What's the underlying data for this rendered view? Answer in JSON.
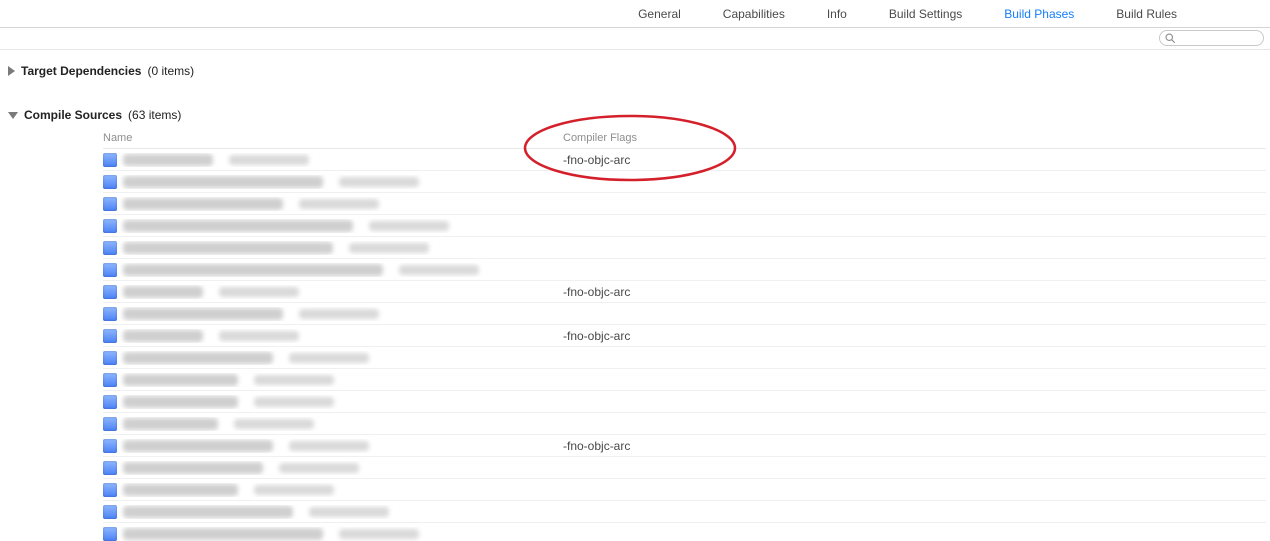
{
  "tabs": {
    "general": "General",
    "capabilities": "Capabilities",
    "info": "Info",
    "build_settings": "Build Settings",
    "build_phases": "Build Phases",
    "build_rules": "Build Rules",
    "active": "build_phases"
  },
  "search": {
    "placeholder": ""
  },
  "sections": {
    "target_deps": {
      "title": "Target Dependencies",
      "count_label": "(0 items)"
    },
    "compile_sources": {
      "title": "Compile Sources",
      "count_label": "(63 items)"
    }
  },
  "columns": {
    "name": "Name",
    "flags": "Compiler Flags"
  },
  "arc_flag": "-fno-objc-arc",
  "rows": [
    {
      "nw": 90,
      "pw": 80,
      "flag_key": "arc_flag"
    },
    {
      "nw": 200,
      "pw": 80,
      "flag_key": null
    },
    {
      "nw": 160,
      "pw": 80,
      "flag_key": null
    },
    {
      "nw": 230,
      "pw": 80,
      "flag_key": null
    },
    {
      "nw": 210,
      "pw": 80,
      "flag_key": null
    },
    {
      "nw": 260,
      "pw": 80,
      "flag_key": null
    },
    {
      "nw": 80,
      "pw": 80,
      "flag_key": "arc_flag"
    },
    {
      "nw": 160,
      "pw": 80,
      "flag_key": null
    },
    {
      "nw": 80,
      "pw": 80,
      "flag_key": "arc_flag"
    },
    {
      "nw": 150,
      "pw": 80,
      "flag_key": null
    },
    {
      "nw": 115,
      "pw": 80,
      "flag_key": null
    },
    {
      "nw": 115,
      "pw": 80,
      "flag_key": null
    },
    {
      "nw": 95,
      "pw": 80,
      "flag_key": null
    },
    {
      "nw": 150,
      "pw": 80,
      "flag_key": "arc_flag"
    },
    {
      "nw": 140,
      "pw": 80,
      "flag_key": null
    },
    {
      "nw": 115,
      "pw": 80,
      "flag_key": null
    },
    {
      "nw": 170,
      "pw": 80,
      "flag_key": null
    },
    {
      "nw": 200,
      "pw": 80,
      "flag_key": null
    }
  ]
}
